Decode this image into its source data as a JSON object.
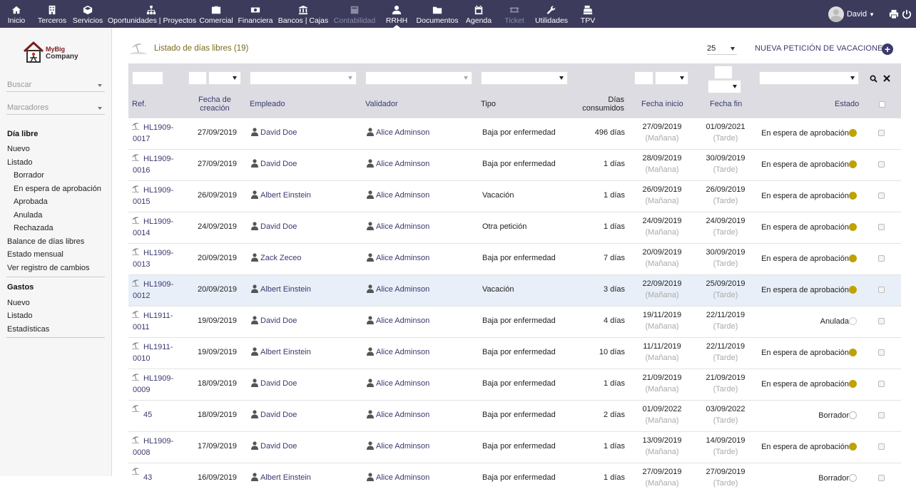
{
  "topmenu": [
    {
      "label": "Inicio",
      "icon": "home-icon"
    },
    {
      "label": "Terceros",
      "icon": "building-icon"
    },
    {
      "label": "Servicios",
      "icon": "cube-icon"
    },
    {
      "label": "Oportunidades | Proyectos",
      "icon": "sitemap-icon"
    },
    {
      "label": "Comercial",
      "icon": "briefcase-icon"
    },
    {
      "label": "Financiera",
      "icon": "money-icon"
    },
    {
      "label": "Bancos | Cajas",
      "icon": "bank-icon"
    },
    {
      "label": "Contabilidad",
      "icon": "calculator-icon"
    },
    {
      "label": "RRHH",
      "icon": "user-tie-icon"
    },
    {
      "label": "Documentos",
      "icon": "folder-icon"
    },
    {
      "label": "Agenda",
      "icon": "calendar-icon"
    },
    {
      "label": "Ticket",
      "icon": "ticket-icon"
    },
    {
      "label": "Utilidades",
      "icon": "wrench-icon"
    },
    {
      "label": "TPV",
      "icon": "cash-register-icon"
    }
  ],
  "user": {
    "name": "David"
  },
  "sidebar": {
    "logo_line1": "MyBig",
    "logo_line2": "Company",
    "search_placeholder": "Buscar",
    "bookmarks_placeholder": "Marcadores",
    "section1_title": "Día libre",
    "section1_items": [
      "Nuevo",
      "Listado",
      "Borrador",
      "En espera de aprobación",
      "Aprobada",
      "Anulada",
      "Rechazada",
      "Balance de días libres",
      "Estado mensual",
      "Ver registro de cambios"
    ],
    "section2_title": "Gastos",
    "section2_items": [
      "Nuevo",
      "Listado",
      "Estadísticas"
    ]
  },
  "page": {
    "title": "Listado de días libres (19)",
    "limit": "25",
    "new_button": "NUEVA PETICIÓN DE VACACIONES"
  },
  "columns": {
    "ref": "Ref.",
    "created_l1": "Fecha de",
    "created_l2": "creación",
    "employee": "Empleado",
    "validator": "Validador",
    "type": "Tipo",
    "days_l1": "Días",
    "days_l2": "consumidos",
    "start": "Fecha inicio",
    "end": "Fecha fin",
    "status": "Estado"
  },
  "colors": {
    "topbar": "#3c3b5b",
    "link": "#3a3a6e",
    "pending_dot": "#bfa200"
  },
  "rows": [
    {
      "ref1": "HL1909-",
      "ref2": "0017",
      "created": "27/09/2019",
      "employee": "David Doe",
      "validator": "Alice Adminson",
      "type": "Baja por enfermedad",
      "days": "496 días",
      "start": "27/09/2019",
      "start_half": "(Mañana)",
      "end": "01/09/2021",
      "end_half": "(Tarde)",
      "status": "En espera de aprobación",
      "dot": "y"
    },
    {
      "ref1": "HL1909-",
      "ref2": "0016",
      "created": "27/09/2019",
      "employee": "David Doe",
      "validator": "Alice Adminson",
      "type": "Baja por enfermedad",
      "days": "1 días",
      "start": "28/09/2019",
      "start_half": "(Mañana)",
      "end": "30/09/2019",
      "end_half": "(Tarde)",
      "status": "En espera de aprobación",
      "dot": "y"
    },
    {
      "ref1": "HL1909-",
      "ref2": "0015",
      "created": "26/09/2019",
      "employee": "Albert Einstein",
      "validator": "Alice Adminson",
      "type": "Vacación",
      "days": "1 días",
      "start": "26/09/2019",
      "start_half": "(Mañana)",
      "end": "26/09/2019",
      "end_half": "(Tarde)",
      "status": "En espera de aprobación",
      "dot": "y"
    },
    {
      "ref1": "HL1909-",
      "ref2": "0014",
      "created": "24/09/2019",
      "employee": "David Doe",
      "validator": "Alice Adminson",
      "type": "Otra petición",
      "days": "1 días",
      "start": "24/09/2019",
      "start_half": "(Mañana)",
      "end": "24/09/2019",
      "end_half": "(Tarde)",
      "status": "En espera de aprobación",
      "dot": "y"
    },
    {
      "ref1": "HL1909-",
      "ref2": "0013",
      "created": "20/09/2019",
      "employee": "Zack Zeceo",
      "validator": "Alice Adminson",
      "type": "Baja por enfermedad",
      "days": "7 días",
      "start": "20/09/2019",
      "start_half": "(Mañana)",
      "end": "30/09/2019",
      "end_half": "(Tarde)",
      "status": "En espera de aprobación",
      "dot": "y"
    },
    {
      "ref1": "HL1909-",
      "ref2": "0012",
      "created": "20/09/2019",
      "employee": "Albert Einstein",
      "validator": "Alice Adminson",
      "type": "Vacación",
      "days": "3 días",
      "start": "22/09/2019",
      "start_half": "(Mañana)",
      "end": "25/09/2019",
      "end_half": "(Tarde)",
      "status": "En espera de aprobación",
      "dot": "y"
    },
    {
      "ref1": "HL1911-",
      "ref2": "0011",
      "created": "19/09/2019",
      "employee": "David Doe",
      "validator": "Alice Adminson",
      "type": "Baja por enfermedad",
      "days": "4 días",
      "start": "19/11/2019",
      "start_half": "(Mañana)",
      "end": "22/11/2019",
      "end_half": "(Tarde)",
      "status": "Anulada",
      "dot": "x"
    },
    {
      "ref1": "HL1911-",
      "ref2": "0010",
      "created": "19/09/2019",
      "employee": "Albert Einstein",
      "validator": "Alice Adminson",
      "type": "Baja por enfermedad",
      "days": "10 días",
      "start": "11/11/2019",
      "start_half": "(Mañana)",
      "end": "22/11/2019",
      "end_half": "(Tarde)",
      "status": "En espera de aprobación",
      "dot": "y"
    },
    {
      "ref1": "HL1909-",
      "ref2": "0009",
      "created": "18/09/2019",
      "employee": "David Doe",
      "validator": "Alice Adminson",
      "type": "Baja por enfermedad",
      "days": "1 días",
      "start": "21/09/2019",
      "start_half": "(Mañana)",
      "end": "21/09/2019",
      "end_half": "(Tarde)",
      "status": "En espera de aprobación",
      "dot": "y"
    },
    {
      "ref1": "45",
      "ref2": "",
      "created": "18/09/2019",
      "employee": "David Doe",
      "validator": "Alice Adminson",
      "type": "Baja por enfermedad",
      "days": "2 días",
      "start": "01/09/2022",
      "start_half": "(Mañana)",
      "end": "03/09/2022",
      "end_half": "(Tarde)",
      "status": "Borrador",
      "dot": "o"
    },
    {
      "ref1": "HL1909-",
      "ref2": "0008",
      "created": "17/09/2019",
      "employee": "David Doe",
      "validator": "Alice Adminson",
      "type": "Baja por enfermedad",
      "days": "1 días",
      "start": "13/09/2019",
      "start_half": "(Mañana)",
      "end": "14/09/2019",
      "end_half": "(Tarde)",
      "status": "En espera de aprobación",
      "dot": "y"
    },
    {
      "ref1": "43",
      "ref2": "",
      "created": "16/09/2019",
      "employee": "Albert Einstein",
      "validator": "Alice Adminson",
      "type": "Baja por enfermedad",
      "days": "1 días",
      "start": "27/09/2019",
      "start_half": "(Mañana)",
      "end": "27/09/2019",
      "end_half": "(Tarde)",
      "status": "Borrador",
      "dot": "o"
    }
  ]
}
